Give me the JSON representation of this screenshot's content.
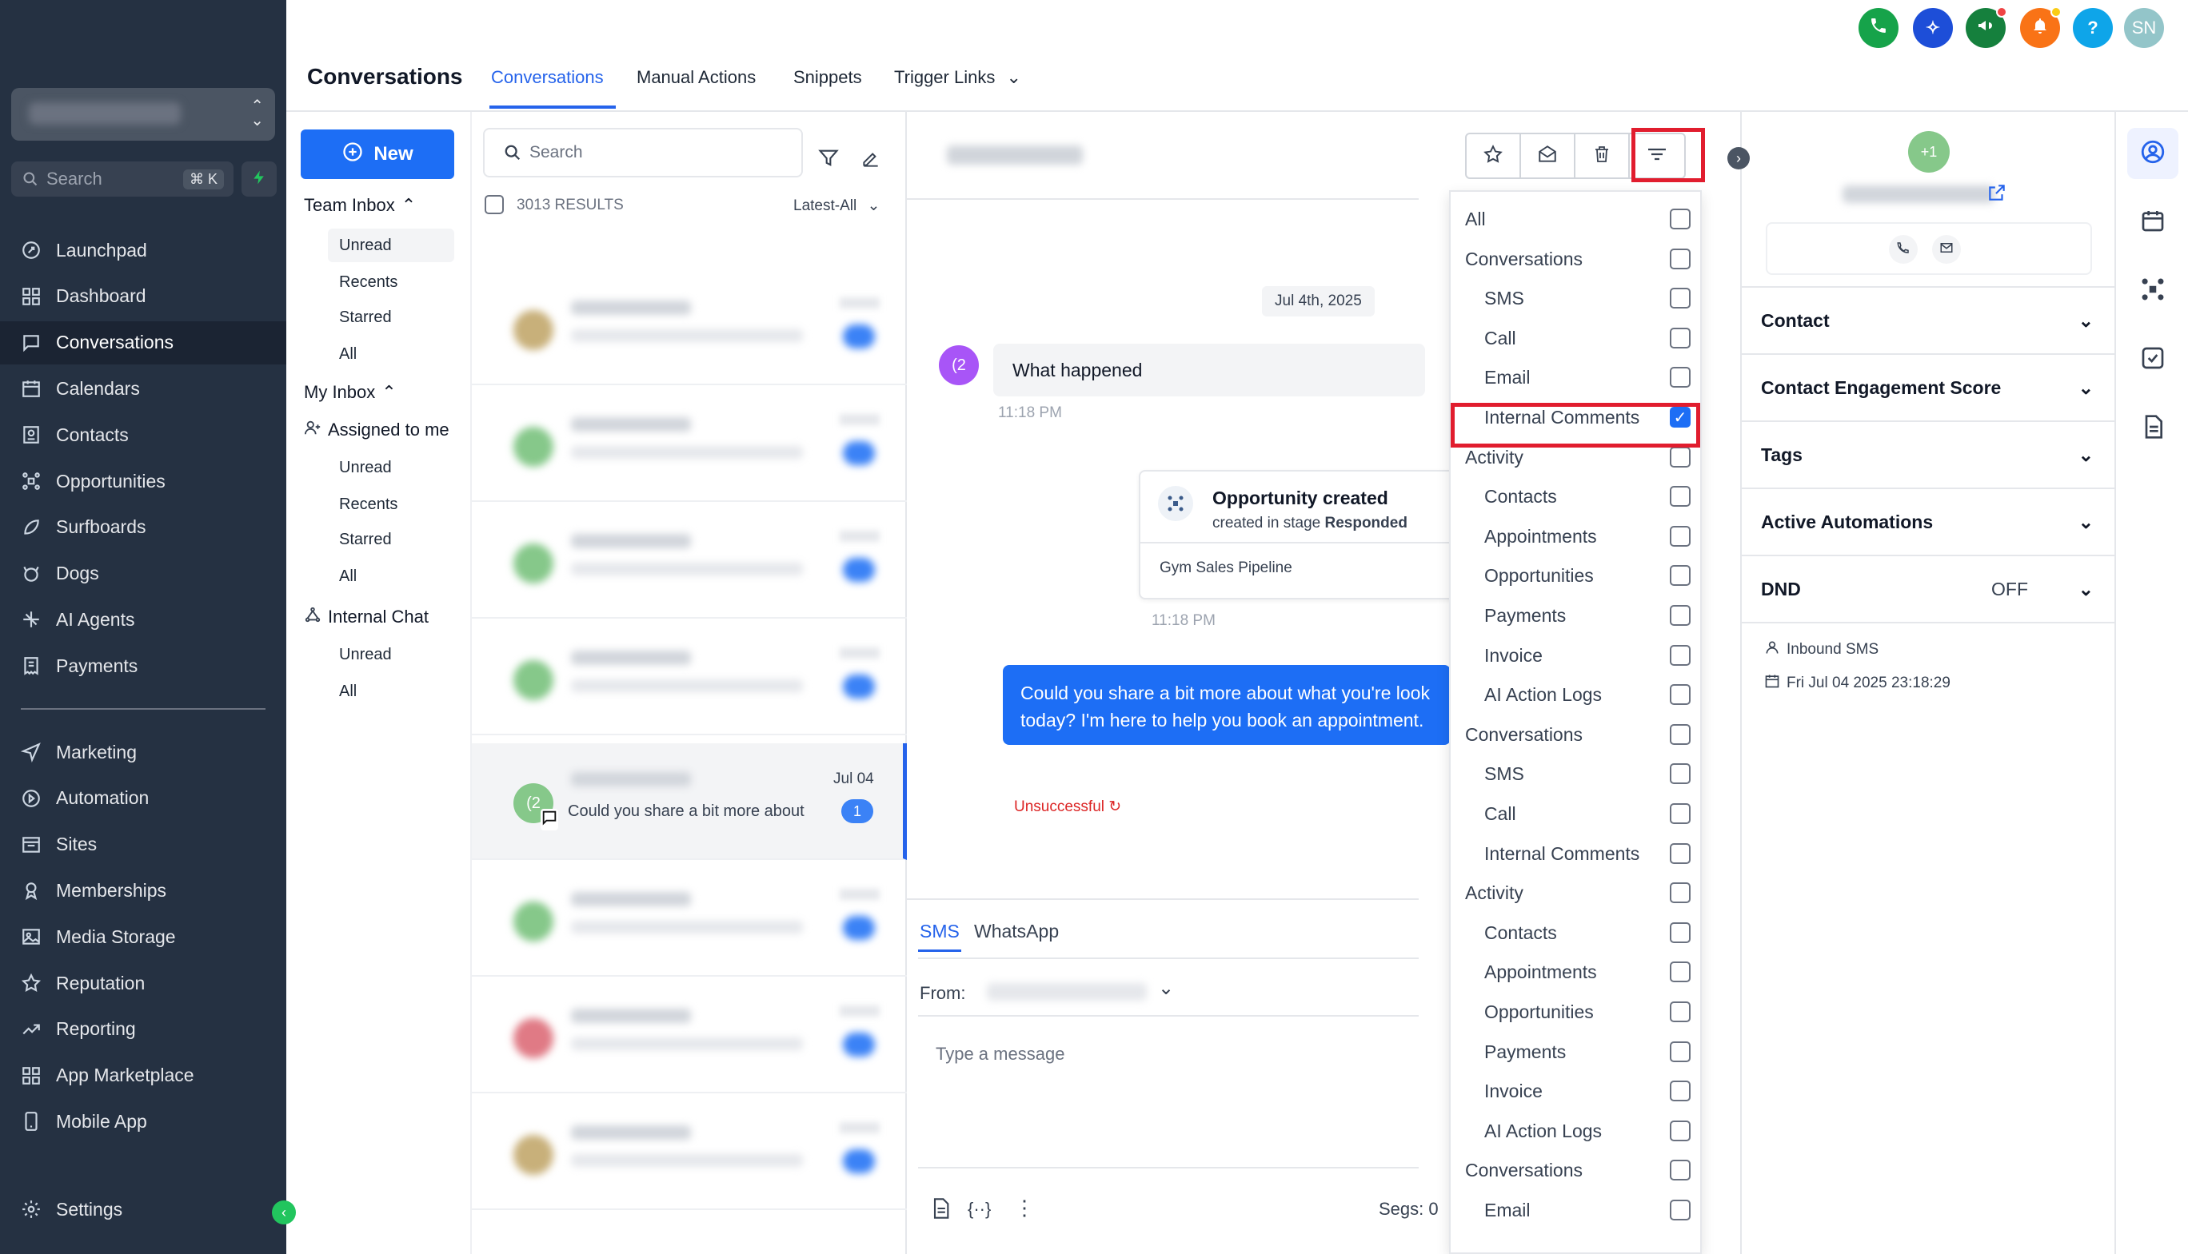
{
  "sidebar": {
    "search_placeholder": "Search",
    "search_shortcut": "⌘ K",
    "nav": [
      {
        "label": "Launchpad",
        "icon": "rocket-icon"
      },
      {
        "label": "Dashboard",
        "icon": "grid-icon"
      },
      {
        "label": "Conversations",
        "icon": "chat-icon",
        "active": true
      },
      {
        "label": "Calendars",
        "icon": "calendar-icon"
      },
      {
        "label": "Contacts",
        "icon": "contacts-icon"
      },
      {
        "label": "Opportunities",
        "icon": "opportunities-icon"
      },
      {
        "label": "Surfboards",
        "icon": "surfboard-icon"
      },
      {
        "label": "Dogs",
        "icon": "dog-icon"
      },
      {
        "label": "AI Agents",
        "icon": "sparkle-icon"
      },
      {
        "label": "Payments",
        "icon": "receipt-icon"
      }
    ],
    "nav2": [
      {
        "label": "Marketing",
        "icon": "send-icon"
      },
      {
        "label": "Automation",
        "icon": "automation-icon"
      },
      {
        "label": "Sites",
        "icon": "sites-icon"
      },
      {
        "label": "Memberships",
        "icon": "membership-icon"
      },
      {
        "label": "Media Storage",
        "icon": "image-icon"
      },
      {
        "label": "Reputation",
        "icon": "star-icon"
      },
      {
        "label": "Reporting",
        "icon": "trend-icon"
      },
      {
        "label": "App Marketplace",
        "icon": "apps-icon"
      },
      {
        "label": "Mobile App",
        "icon": "mobile-icon"
      }
    ],
    "settings": "Settings"
  },
  "topbar": {
    "title": "Conversations",
    "tabs": [
      "Conversations",
      "Manual Actions",
      "Snippets",
      "Trigger Links"
    ],
    "avatar_initials": "SN"
  },
  "inbox": {
    "new_label": "New",
    "team_inbox": "Team Inbox",
    "team_items": [
      "Unread",
      "Recents",
      "Starred",
      "All"
    ],
    "my_inbox": "My Inbox",
    "assigned": "Assigned to me",
    "my_items": [
      "Unread",
      "Recents",
      "Starred",
      "All"
    ],
    "internal_chat": "Internal Chat",
    "chat_items": [
      "Unread",
      "All"
    ]
  },
  "list": {
    "search_placeholder": "Search",
    "results": "3013 RESULTS",
    "sort": "Latest-All",
    "selected_row": {
      "avatar": "(2",
      "preview": "Could you share a bit more about",
      "date": "Jul 04",
      "unread": "1"
    }
  },
  "chat": {
    "date_chip": "Jul 4th, 2025",
    "incoming_avatar": "(2",
    "incoming_text": "What happened",
    "incoming_time": "11:18 PM",
    "opp_title": "Opportunity created",
    "opp_sub_prefix": "created in stage ",
    "opp_stage": "Responded",
    "opp_pipeline": "Gym Sales Pipeline",
    "opp_time": "11:18 PM",
    "outgoing_line1": "Could you share a bit more about what you're look",
    "outgoing_line2": "today? I'm here to help you book an appointment.",
    "status": "Unsuccessful",
    "composer_tabs": [
      "SMS",
      "WhatsApp"
    ],
    "from_label": "From:",
    "message_placeholder": "Type a message",
    "segs": "Segs: 0"
  },
  "filter_dropdown": {
    "options": [
      {
        "label": "All",
        "indent": false,
        "checked": false
      },
      {
        "label": "Conversations",
        "indent": false,
        "checked": false
      },
      {
        "label": "SMS",
        "indent": true,
        "checked": false
      },
      {
        "label": "Call",
        "indent": true,
        "checked": false
      },
      {
        "label": "Email",
        "indent": true,
        "checked": false
      },
      {
        "label": "Internal Comments",
        "indent": true,
        "checked": true
      },
      {
        "label": "Activity",
        "indent": false,
        "checked": false
      },
      {
        "label": "Contacts",
        "indent": true,
        "checked": false
      },
      {
        "label": "Appointments",
        "indent": true,
        "checked": false
      },
      {
        "label": "Opportunities",
        "indent": true,
        "checked": false
      },
      {
        "label": "Payments",
        "indent": true,
        "checked": false
      },
      {
        "label": "Invoice",
        "indent": true,
        "checked": false
      },
      {
        "label": "AI Action Logs",
        "indent": true,
        "checked": false
      },
      {
        "label": "Conversations",
        "indent": false,
        "checked": false
      },
      {
        "label": "SMS",
        "indent": true,
        "checked": false
      },
      {
        "label": "Call",
        "indent": true,
        "checked": false
      },
      {
        "label": "Internal Comments",
        "indent": true,
        "checked": false
      },
      {
        "label": "Activity",
        "indent": false,
        "checked": false
      },
      {
        "label": "Contacts",
        "indent": true,
        "checked": false
      },
      {
        "label": "Appointments",
        "indent": true,
        "checked": false
      },
      {
        "label": "Opportunities",
        "indent": true,
        "checked": false
      },
      {
        "label": "Payments",
        "indent": true,
        "checked": false
      },
      {
        "label": "Invoice",
        "indent": true,
        "checked": false
      },
      {
        "label": "AI Action Logs",
        "indent": true,
        "checked": false
      },
      {
        "label": "Conversations",
        "indent": false,
        "checked": false
      },
      {
        "label": "Email",
        "indent": true,
        "checked": false
      }
    ]
  },
  "contact_panel": {
    "badge": "+1",
    "sections": [
      "Contact",
      "Contact Engagement Score",
      "Tags",
      "Active Automations",
      "DND"
    ],
    "dnd_value": "OFF",
    "source": "Inbound SMS",
    "created": "Fri Jul 04 2025 23:18:29"
  },
  "colors": {
    "primary": "#1d6ef5",
    "sidebar": "#253142",
    "highlight": "#e11d2e"
  }
}
